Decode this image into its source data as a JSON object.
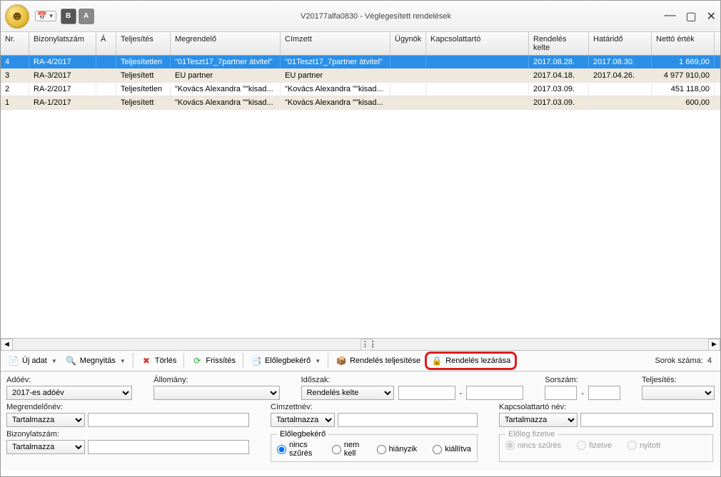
{
  "window": {
    "title": "V20177alfa0830 - Véglegesített rendelések",
    "toolbar_badge_b": "B",
    "toolbar_badge_a": "A"
  },
  "columns": {
    "nr": "Nr.",
    "bizonylat": "Bizonylatszám",
    "a": "Á",
    "teljesites": "Teljesítés",
    "megrendelo": "Megrendelő",
    "cimzett": "Címzett",
    "ugynok": "Ügynök",
    "kapcsolat": "Kapcsolattartó",
    "rendeles_kelte": "Rendelés kelte",
    "hatarido": "Határidő",
    "netto": "Nettó érték"
  },
  "rows": [
    {
      "nr": "4",
      "biz": "RA-4/2017",
      "a": "",
      "tel": "Teljesítetlen",
      "meg": "\"01Teszt17_7partner átvitel\"",
      "cim": "\"01Teszt17_7partner átvitel\"",
      "ugy": "",
      "kap": "",
      "ren": "2017.08.28.",
      "hat": "2017.08.30.",
      "net": "1 669,00",
      "sel": true,
      "alt": false
    },
    {
      "nr": "3",
      "biz": "RA-3/2017",
      "a": "",
      "tel": "Teljesített",
      "meg": "EU partner",
      "cim": "EU partner",
      "ugy": "",
      "kap": "",
      "ren": "2017.04.18.",
      "hat": "2017.04.26.",
      "net": "4 977 910,00",
      "sel": false,
      "alt": true
    },
    {
      "nr": "2",
      "biz": "RA-2/2017",
      "a": "",
      "tel": "Teljesítetlen",
      "meg": "\"Kovács Alexandra \"\"kisad...",
      "cim": "\"Kovács Alexandra \"\"kisad...",
      "ugy": "",
      "kap": "",
      "ren": "2017.03.09.",
      "hat": "",
      "net": "451 118,00",
      "sel": false,
      "alt": false
    },
    {
      "nr": "1",
      "biz": "RA-1/2017",
      "a": "",
      "tel": "Teljesített",
      "meg": "\"Kovács Alexandra \"\"kisad...",
      "cim": "\"Kovács Alexandra \"\"kisad...",
      "ugy": "",
      "kap": "",
      "ren": "2017.03.09.",
      "hat": "",
      "net": "600,00",
      "sel": false,
      "alt": true
    }
  ],
  "toolbar": {
    "uj_adat": "Új adat",
    "megnyitas": "Megnyitás",
    "torles": "Törlés",
    "frissites": "Frissítés",
    "elolegbekero": "Előlegbekérő",
    "rendeles_teljesitese": "Rendelés teljesítése",
    "rendeles_lezarasa": "Rendelés lezárása",
    "sorok_szama_label": "Sorok száma:",
    "sorok_szama_value": "4"
  },
  "filters": {
    "adoev_label": "Adóév:",
    "adoev_value": "2017-es adóév",
    "allomany_label": "Állomány:",
    "allomany_value": "",
    "idoszak_label": "Időszak:",
    "idoszak_value": "Rendelés kelte",
    "idoszak_from": "",
    "idoszak_to": "",
    "sorszam_label": "Sorszám:",
    "sorszam_from": "",
    "sorszam_to": "",
    "teljesites_label": "Teljesítés:",
    "teljesites_value": "",
    "megrendelonev_label": "Megrendelőnév:",
    "megrendelonev_mode": "Tartalmazza",
    "megrendelonev_value": "",
    "cimzettnev_label": "Címzettnév:",
    "cimzettnev_mode": "Tartalmazza",
    "cimzettnev_value": "",
    "kapcsolattarto_label": "Kapcsolattartó név:",
    "kapcsolattarto_mode": "Tartalmazza",
    "kapcsolattarto_value": "",
    "bizonylatszam_label": "Bizonylatszám:",
    "bizonylatszam_mode": "Tartalmazza",
    "bizonylatszam_value": "",
    "elolegbekero_legend": "Előlegbekérő",
    "eleg_nincs": "nincs szűrés",
    "eleg_nemkell": "nem kell",
    "eleg_hianyzik": "hiányzik",
    "eleg_kiallitva": "kiállítva",
    "elolegfizetve_legend": "Előleg fizetve",
    "ef_nincs": "nincs szűrés",
    "ef_fizetve": "fizetve",
    "ef_nyitott": "nyitott"
  }
}
